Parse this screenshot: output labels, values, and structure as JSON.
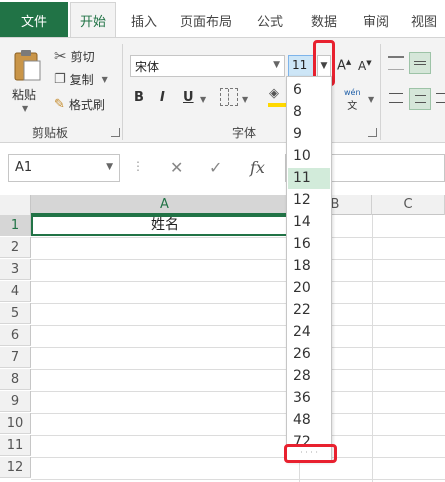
{
  "tabs": {
    "file": "文件",
    "items": [
      "开始",
      "插入",
      "页面布局",
      "公式",
      "数据",
      "审阅",
      "视图"
    ]
  },
  "clipboard": {
    "paste": "粘贴",
    "cut": "剪切",
    "copy": "复制",
    "format_painter": "格式刷",
    "group_label": "剪贴板"
  },
  "font": {
    "name": "宋体",
    "size": "11",
    "bold": "B",
    "italic": "I",
    "underline": "U",
    "grow": "A",
    "shrink": "A",
    "phonetic_top": "wén",
    "phonetic_bottom": "文",
    "group_label": "字体"
  },
  "formula_bar": {
    "name_box": "A1",
    "cancel": "✕",
    "enter": "✓",
    "fx": "fx"
  },
  "grid": {
    "columns": [
      "A",
      "B",
      "C"
    ],
    "rows": [
      "1",
      "2",
      "3",
      "4",
      "5",
      "6",
      "7",
      "8",
      "9",
      "10",
      "11",
      "12"
    ],
    "cell_a1": "姓名"
  },
  "size_dropdown": {
    "options": [
      "6",
      "8",
      "9",
      "10",
      "11",
      "12",
      "14",
      "16",
      "18",
      "20",
      "22",
      "24",
      "26",
      "28",
      "36",
      "48",
      "72"
    ],
    "selected": "11",
    "grip": "· · · ·"
  },
  "colors": {
    "accent": "#217346",
    "highlight_box": "#e8212f",
    "selected_size": "#d2ebda"
  }
}
